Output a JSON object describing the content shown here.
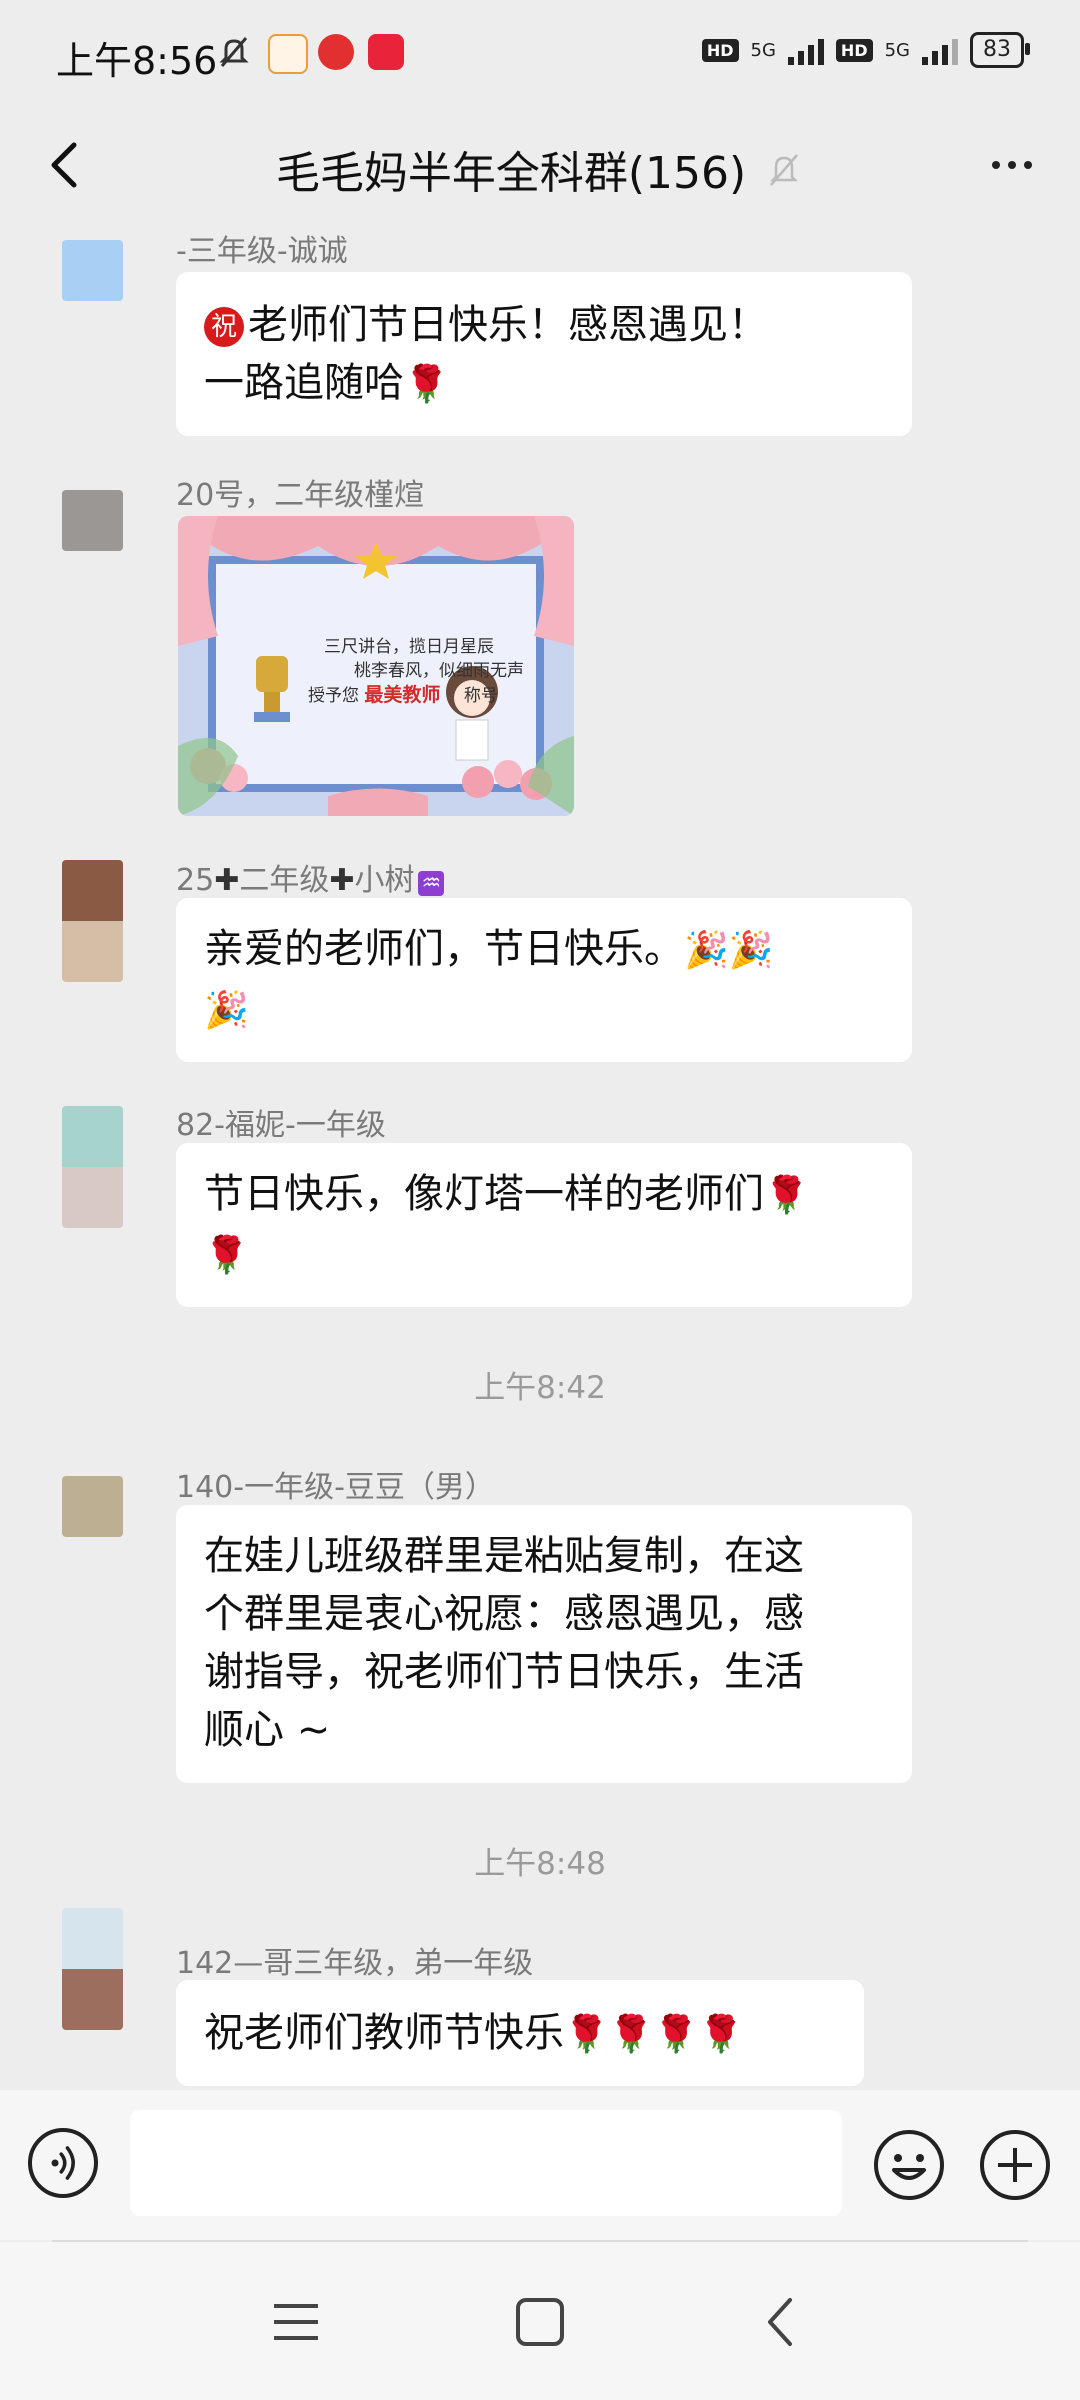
{
  "status_bar": {
    "time": "上午8:56",
    "hd1": "HD",
    "net1": "5G",
    "hd2": "HD",
    "net2": "5G",
    "battery": "83"
  },
  "header": {
    "title": "毛毛妈半年全科群(156)"
  },
  "messages": [
    {
      "sender": "-三年级-诚诚",
      "badge": "祝",
      "line1": "老师们节日快乐！感恩遇见！",
      "line2": "一路追随哈",
      "emoji": "🌹"
    },
    {
      "sender": "20号，二年级槿煊",
      "image": {
        "line1": "三尺讲台，揽日月星辰",
        "line2": "桃李春风，似细雨无声",
        "line3_pre": "授予您",
        "line3_title": "最美教师",
        "line3_post": "称号"
      }
    },
    {
      "sender_pre": "25",
      "sender_mid": "二年级",
      "sender_post": "小树",
      "sender_emoji": "♒",
      "line1": "亲爱的老师们，节日快乐。",
      "emoji": "🎉"
    },
    {
      "sender": "82-福妮-一年级",
      "line1": "节日快乐，像灯塔一样的老师们",
      "emoji": "🌹"
    },
    {
      "sender": "140-一年级-豆豆（男）",
      "line1": "在娃儿班级群里是粘贴复制，在这",
      "line2": "个群里是衷心祝愿：感恩遇见，感",
      "line3": "谢指导，祝老师们节日快乐，生活",
      "line4": "顺心 ~"
    },
    {
      "sender": "142—哥三年级，弟一年级",
      "line1": "祝老师们教师节快乐",
      "emoji": "🌹"
    }
  ],
  "time_dividers": [
    "上午8:42",
    "上午8:48"
  ],
  "colors": {
    "background": "#ededed",
    "bubble": "#ffffff",
    "sender_text": "#7a7a7a",
    "red_badge": "#d71a1a"
  },
  "icons": [
    "back-arrow-icon",
    "mute-bell-icon",
    "more-dots-icon",
    "voice-icon",
    "emoji-icon",
    "add-icon",
    "menu-icon",
    "home-icon",
    "back-nav-icon"
  ]
}
